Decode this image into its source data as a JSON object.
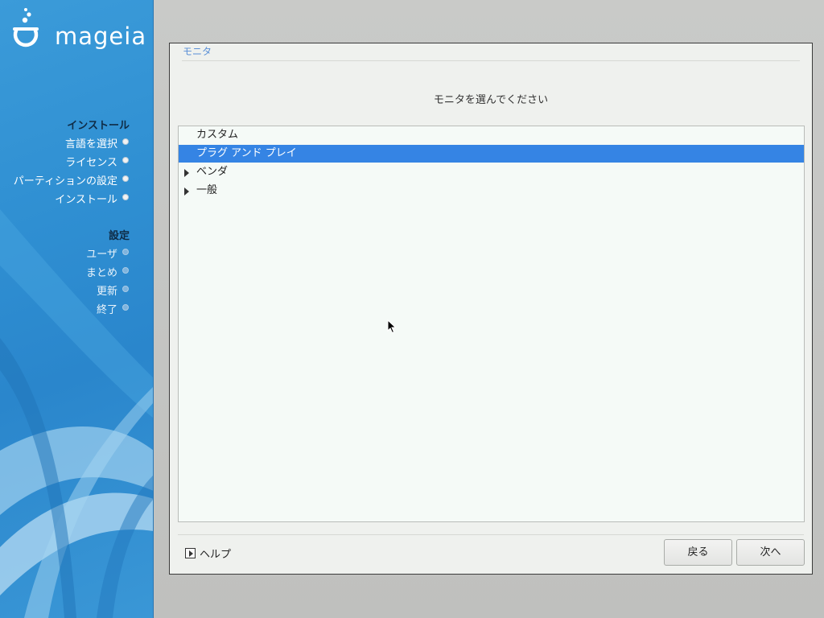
{
  "sidebar": {
    "logo_text": "mageia",
    "sections": [
      {
        "title": "インストール",
        "items": [
          {
            "label": "言語を選択",
            "state": "done"
          },
          {
            "label": "ライセンス",
            "state": "done"
          },
          {
            "label": "パーティションの設定",
            "state": "done"
          },
          {
            "label": "インストール",
            "state": "done"
          }
        ]
      },
      {
        "title": "設定",
        "items": [
          {
            "label": "ユーザ",
            "state": "future"
          },
          {
            "label": "まとめ",
            "state": "future"
          },
          {
            "label": "更新",
            "state": "future"
          },
          {
            "label": "終了",
            "state": "future"
          }
        ]
      }
    ]
  },
  "dialog": {
    "title": "モニタ",
    "subtitle": "モニタを選んでください",
    "tree": [
      {
        "label": "カスタム",
        "expandable": false,
        "selected": false
      },
      {
        "label": "プラグ アンド プレイ",
        "expandable": false,
        "selected": true
      },
      {
        "label": "ベンダ",
        "expandable": true,
        "selected": false
      },
      {
        "label": "一般",
        "expandable": true,
        "selected": false
      }
    ],
    "help_label": "ヘルプ",
    "back_label": "戻る",
    "next_label": "次へ"
  },
  "colors": {
    "accent": "#3584e4",
    "title": "#5a8fd6",
    "sidebar": "#2f8fd2"
  }
}
